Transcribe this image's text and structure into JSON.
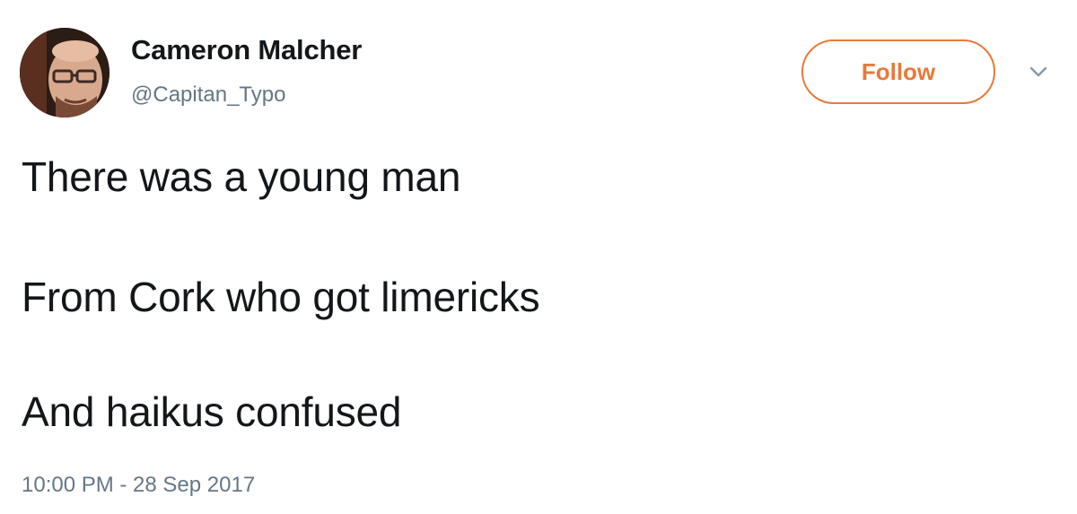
{
  "user": {
    "name": "Cameron Malcher",
    "handle": "@Capitan_Typo"
  },
  "follow_label": "Follow",
  "tweet": {
    "lines": [
      "There was a young man",
      "From Cork who got limericks",
      "And haikus confused"
    ],
    "timestamp": "10:00 PM - 28 Sep 2017"
  },
  "icons": {
    "more": "chevron-down-icon"
  },
  "colors": {
    "follow_accent": "#e8793a",
    "secondary_text": "#657786",
    "primary_text": "#14171a"
  }
}
